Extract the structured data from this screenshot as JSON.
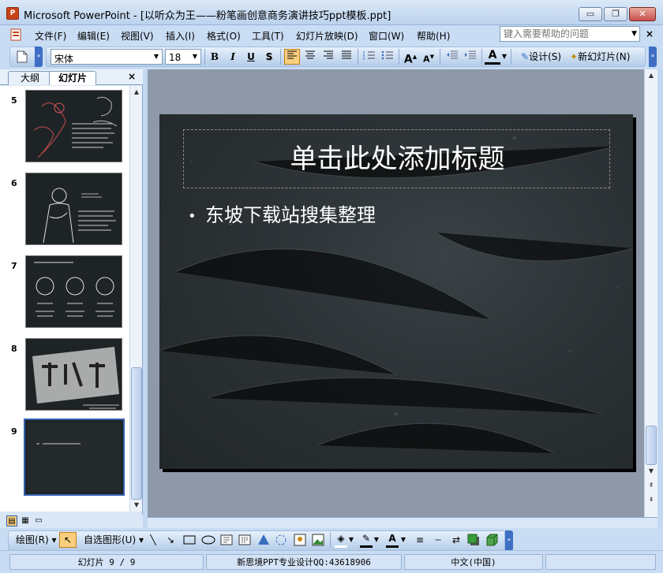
{
  "window": {
    "title": "Microsoft PowerPoint - [以听众为王——粉笔画创意商务演讲技巧ppt模板.ppt]",
    "app_icon_letter": "P",
    "minimize_glyph": "▭",
    "restore_glyph": "❐",
    "close_glyph": "✕"
  },
  "menu": {
    "items": [
      "文件(F)",
      "编辑(E)",
      "视图(V)",
      "插入(I)",
      "格式(O)",
      "工具(T)",
      "幻灯片放映(D)",
      "窗口(W)",
      "帮助(H)"
    ],
    "help_placeholder": "键入需要帮助的问题"
  },
  "toolbar": {
    "font_name": "宋体",
    "font_size": "18",
    "bold": "B",
    "italic": "I",
    "underline": "U",
    "shadow": "S",
    "font_color_label": "A",
    "grow_font": "A",
    "shrink_font": "A",
    "design_label": "设计(S)",
    "new_slide_label": "新幻灯片(N)"
  },
  "left_pane": {
    "tab_outline": "大纲",
    "tab_slides": "幻灯片",
    "close_glyph": "×",
    "thumbnails": [
      {
        "number": "5",
        "selected": false
      },
      {
        "number": "6",
        "selected": false
      },
      {
        "number": "7",
        "selected": false
      },
      {
        "number": "8",
        "selected": false
      },
      {
        "number": "9",
        "selected": true
      }
    ]
  },
  "slide": {
    "title": "单击此处添加标题",
    "bullet_glyph": "•",
    "bullet": "东坡下载站搜集整理"
  },
  "draw_toolbar": {
    "draw_label": "绘图(R)",
    "autoshapes_label": "自选图形(U)",
    "font_color_label": "A"
  },
  "status": {
    "slide_position": "幻灯片 9 / 9",
    "design_name": "新思境PPT专业设计QQ:43618906",
    "language": "中文(中国)"
  },
  "colors": {
    "chrome": "#c8dcf3",
    "slide_bg": "#2c3235",
    "selection": "#3560b0",
    "active_button": "#f9cf7e"
  }
}
